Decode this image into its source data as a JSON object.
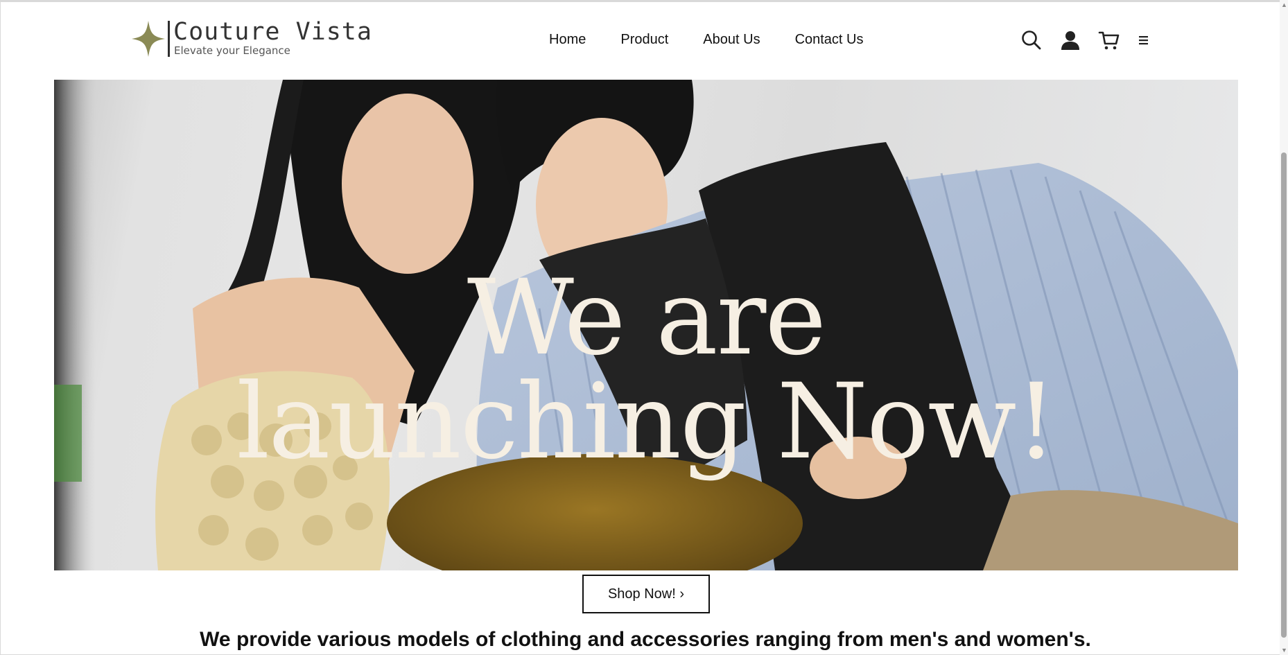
{
  "brand": {
    "name": "Couture Vista",
    "tagline": "Elevate your Elegance",
    "accent_color": "#8a8a55"
  },
  "nav": {
    "items": [
      {
        "label": "Home"
      },
      {
        "label": "Product"
      },
      {
        "label": "About Us"
      },
      {
        "label": "Contact Us"
      }
    ]
  },
  "header_icons": [
    "search-icon",
    "user-icon",
    "cart-icon",
    "menu-icon"
  ],
  "hero": {
    "line1": "We are",
    "line2": "launching Now!",
    "heading_color": "#f6efe3",
    "cta_label": "Shop Now! ›"
  },
  "tagline": "We provide various models of clothing and accessories ranging from men's and women's."
}
